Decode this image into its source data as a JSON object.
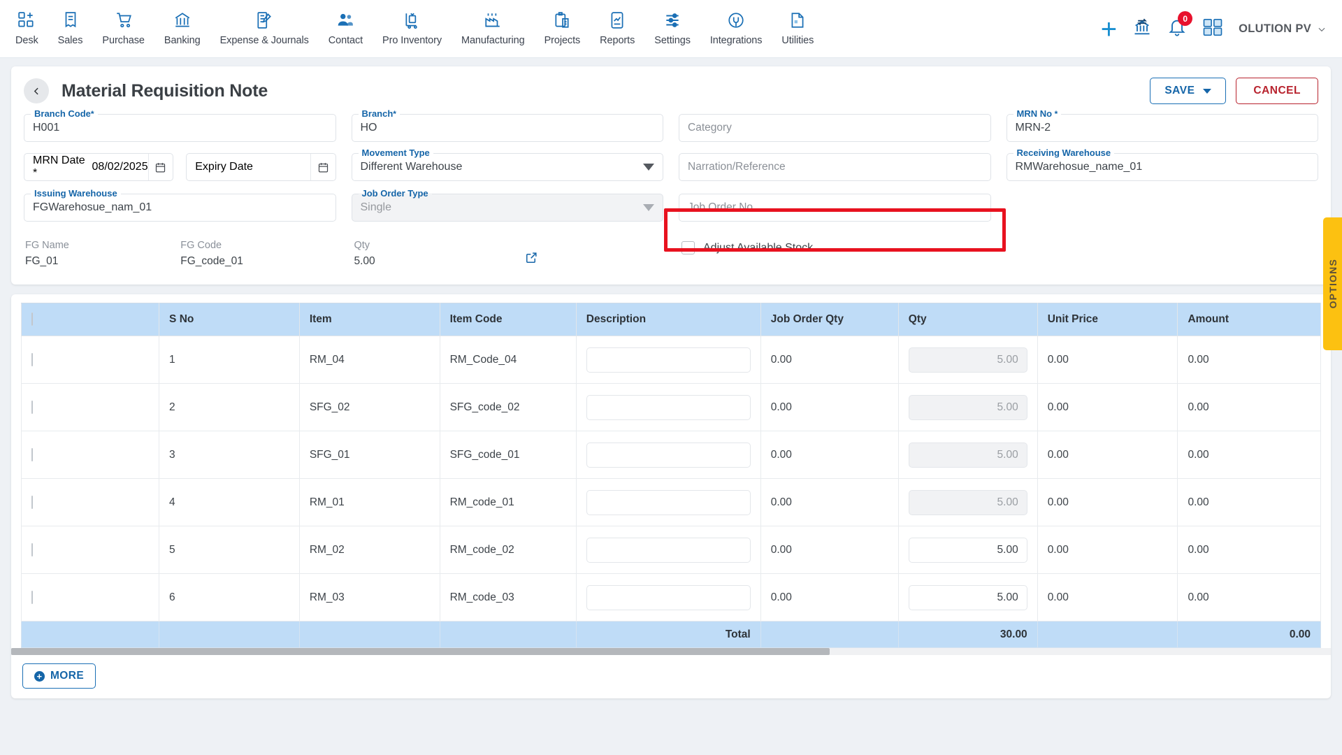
{
  "topnav": {
    "items": [
      {
        "label": "Desk",
        "icon": "desk-icon"
      },
      {
        "label": "Sales",
        "icon": "sales-receipt-icon"
      },
      {
        "label": "Purchase",
        "icon": "cart-icon"
      },
      {
        "label": "Banking",
        "icon": "bank-icon"
      },
      {
        "label": "Expense & Journals",
        "icon": "journal-pen-icon"
      },
      {
        "label": "Contact",
        "icon": "contacts-icon"
      },
      {
        "label": "Pro Inventory",
        "icon": "inventory-trolley-icon"
      },
      {
        "label": "Manufacturing",
        "icon": "factory-icon"
      },
      {
        "label": "Projects",
        "icon": "clipboard-icon"
      },
      {
        "label": "Reports",
        "icon": "report-chart-icon"
      },
      {
        "label": "Settings",
        "icon": "sliders-icon"
      },
      {
        "label": "Integrations",
        "icon": "plug-icon"
      },
      {
        "label": "Utilities",
        "icon": "utilities-icon"
      }
    ],
    "add_icon": "plus-icon",
    "bank_transfer_icon": "bank-transfer-icon",
    "notifications_icon": "bell-icon",
    "notifications_count": "0",
    "apps_icon": "grid-apps-icon",
    "user_name": "OLUTION PV",
    "user_chevron_icon": "chevron-down-icon"
  },
  "header": {
    "back_icon": "chevron-left-icon",
    "title": "Material Requisition Note",
    "save_label": "SAVE",
    "save_caret_icon": "caret-down-icon",
    "cancel_label": "CANCEL"
  },
  "form": {
    "branch_code": {
      "label": "Branch Code",
      "required": "*",
      "value": "H001"
    },
    "branch": {
      "label": "Branch",
      "required": "*",
      "value": "HO"
    },
    "category": {
      "placeholder": "Category",
      "value": ""
    },
    "mrn_no": {
      "label": "MRN No",
      "required": "*",
      "value": "MRN-2"
    },
    "mrn_date": {
      "label": "MRN Date",
      "required": "*",
      "value": "08/02/2025",
      "calendar_icon": "calendar-icon"
    },
    "expiry_date": {
      "placeholder": "Expiry Date",
      "value": "",
      "calendar_icon": "calendar-icon"
    },
    "movement_type": {
      "label": "Movement Type",
      "value": "Different Warehouse",
      "chevron_icon": "chevron-down-icon"
    },
    "narration": {
      "placeholder": "Narration/Reference",
      "value": ""
    },
    "receiving_warehouse": {
      "label": "Receiving Warehouse",
      "value": "RMWarehosue_name_01"
    },
    "issuing_warehouse": {
      "label": "Issuing Warehouse",
      "value": "FGWarehosue_nam_01"
    },
    "job_order_type": {
      "label": "Job Order Type",
      "value": "Single",
      "chevron_icon": "chevron-down-icon"
    },
    "job_order_no": {
      "placeholder": "Job Order No",
      "value": "",
      "highlight_color": "#e8121f"
    },
    "fg_name": {
      "label": "FG Name",
      "value": "FG_01"
    },
    "fg_code": {
      "label": "FG Code",
      "value": "FG_code_01"
    },
    "qty": {
      "label": "Qty",
      "value": "5.00"
    },
    "open_external_icon": "external-link-icon",
    "adjust_stock": {
      "label": "Adjust Available Stock",
      "checked": "false"
    }
  },
  "table": {
    "columns": [
      "",
      "S No",
      "Item",
      "Item Code",
      "Description",
      "Job Order Qty",
      "Qty",
      "Unit Price",
      "Amount"
    ],
    "rows": [
      {
        "s_no": "1",
        "item": "RM_04",
        "item_code": "RM_Code_04",
        "description": "",
        "job_order_qty": "0.00",
        "qty": "5.00",
        "qty_enabled": "false",
        "unit_price": "0.00",
        "amount": "0.00"
      },
      {
        "s_no": "2",
        "item": "SFG_02",
        "item_code": "SFG_code_02",
        "description": "",
        "job_order_qty": "0.00",
        "qty": "5.00",
        "qty_enabled": "false",
        "unit_price": "0.00",
        "amount": "0.00"
      },
      {
        "s_no": "3",
        "item": "SFG_01",
        "item_code": "SFG_code_01",
        "description": "",
        "job_order_qty": "0.00",
        "qty": "5.00",
        "qty_enabled": "false",
        "unit_price": "0.00",
        "amount": "0.00"
      },
      {
        "s_no": "4",
        "item": "RM_01",
        "item_code": "RM_code_01",
        "description": "",
        "job_order_qty": "0.00",
        "qty": "5.00",
        "qty_enabled": "false",
        "unit_price": "0.00",
        "amount": "0.00"
      },
      {
        "s_no": "5",
        "item": "RM_02",
        "item_code": "RM_code_02",
        "description": "",
        "job_order_qty": "0.00",
        "qty": "5.00",
        "qty_enabled": "true",
        "unit_price": "0.00",
        "amount": "0.00"
      },
      {
        "s_no": "6",
        "item": "RM_03",
        "item_code": "RM_code_03",
        "description": "",
        "job_order_qty": "0.00",
        "qty": "5.00",
        "qty_enabled": "true",
        "unit_price": "0.00",
        "amount": "0.00"
      }
    ],
    "total": {
      "label": "Total",
      "qty": "30.00",
      "amount": "0.00"
    }
  },
  "footer": {
    "more_label": "MORE",
    "more_icon": "plus-circle-icon"
  },
  "options_tab": {
    "label": "OPTIONS",
    "color": "#fcc111"
  }
}
